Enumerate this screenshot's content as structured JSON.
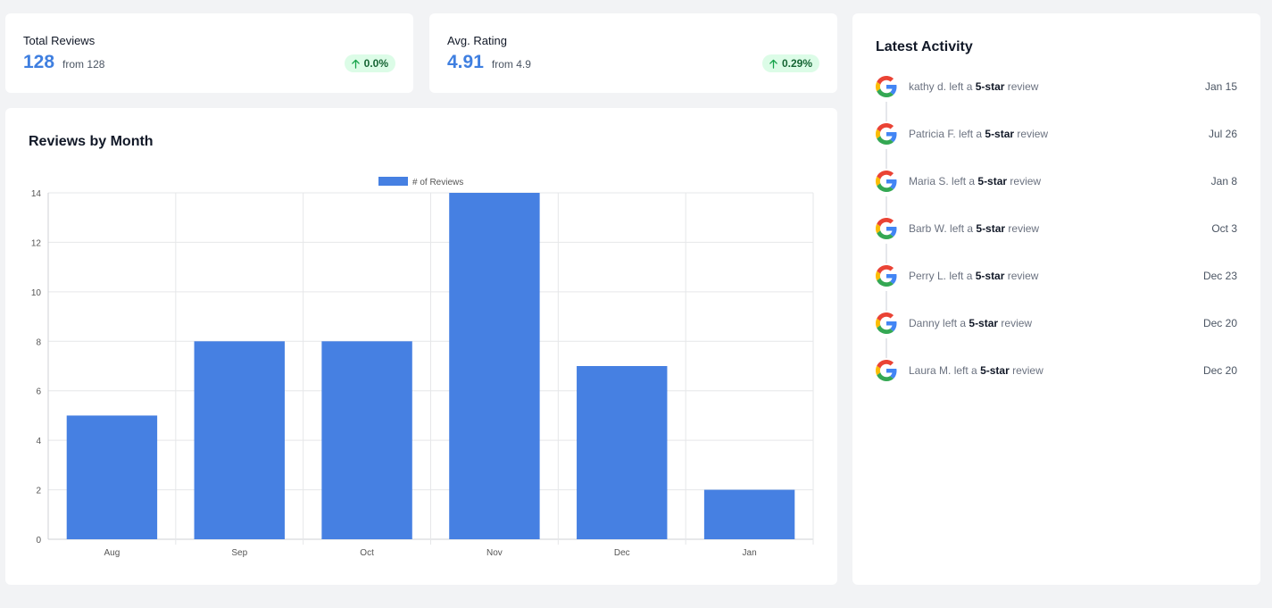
{
  "stats": [
    {
      "label": "Total Reviews",
      "value": "128",
      "from_prefix": "from",
      "from_value": "128",
      "change": "0.0%"
    },
    {
      "label": "Avg. Rating",
      "value": "4.91",
      "from_prefix": "from",
      "from_value": "4.9",
      "change": "0.29%"
    }
  ],
  "chart_title": "Reviews by Month",
  "chart_data": {
    "type": "bar",
    "categories": [
      "Aug",
      "Sep",
      "Oct",
      "Nov",
      "Dec",
      "Jan"
    ],
    "series": [
      {
        "name": "# of Reviews",
        "values": [
          5,
          8,
          8,
          14,
          7,
          2
        ]
      }
    ],
    "ylim": [
      0,
      14
    ],
    "yticks": [
      0,
      2,
      4,
      6,
      8,
      10,
      12,
      14
    ],
    "grid": true,
    "legend": "top-center",
    "color": "#4680e2"
  },
  "activity": {
    "title": "Latest Activity",
    "icon": "google-icon",
    "items": [
      {
        "name": "kathy d.",
        "mid": "left a",
        "rating": "5-star",
        "suffix": "review",
        "date": "Jan 15"
      },
      {
        "name": "Patricia F.",
        "mid": "left a",
        "rating": "5-star",
        "suffix": "review",
        "date": "Jul 26"
      },
      {
        "name": "Maria S.",
        "mid": "left a",
        "rating": "5-star",
        "suffix": "review",
        "date": "Jan 8"
      },
      {
        "name": "Barb W.",
        "mid": "left a",
        "rating": "5-star",
        "suffix": "review",
        "date": "Oct 3"
      },
      {
        "name": "Perry L.",
        "mid": "left a",
        "rating": "5-star",
        "suffix": "review",
        "date": "Dec 23"
      },
      {
        "name": "Danny",
        "mid": "left a",
        "rating": "5-star",
        "suffix": "review",
        "date": "Dec 20"
      },
      {
        "name": "Laura M.",
        "mid": "left a",
        "rating": "5-star",
        "suffix": "review",
        "date": "Dec 20"
      }
    ]
  }
}
